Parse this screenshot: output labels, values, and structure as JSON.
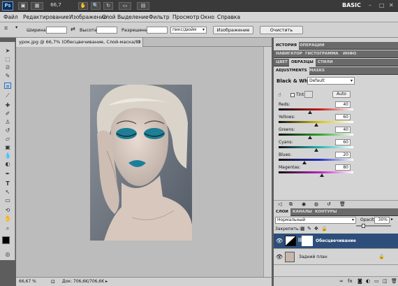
{
  "appbar": {
    "logo": "Ps",
    "zoom": "66,7",
    "workspace": "BASIC"
  },
  "menu": [
    "Файл",
    "Редактирование",
    "Изображение",
    "Слой",
    "Выделение",
    "Фильтр",
    "Просмотр",
    "Окно",
    "Справка"
  ],
  "options": {
    "width_label": "Ширина:",
    "height_label": "Высота:",
    "res_label": "Разрешение:",
    "units": "пикс/дюйм",
    "image_btn": "Изображение",
    "clear_btn": "Очистить"
  },
  "document": {
    "tab_title": "урок.jpg @ 66,7% (Обесцвечивание, Слой-маска/8) *",
    "zoom": "66,67 %",
    "doc_info": "Док: 706,6K/706,6K"
  },
  "panels": {
    "row1": [
      "ИСТОРИЯ",
      "ОПЕРАЦИИ"
    ],
    "row2": [
      "НАВИГАТОР",
      "ГИСТОГРАММА",
      "ИНФО"
    ],
    "row3": [
      "ЦВЕТ",
      "ОБРАЗЦЫ",
      "СТИЛИ"
    ],
    "row4": [
      "ADJUSTMENTS",
      "MASKS"
    ],
    "bw_title": "Black & White",
    "preset": "Default",
    "tint": "Tint",
    "auto": "Auto",
    "sliders": [
      {
        "label": "Reds:",
        "value": "40",
        "pct": 0.42,
        "color": "#c41a1a"
      },
      {
        "label": "Yellows:",
        "value": "60",
        "pct": 0.5,
        "color": "#d9c21a"
      },
      {
        "label": "Greens:",
        "value": "40",
        "pct": 0.42,
        "color": "#2aa32a"
      },
      {
        "label": "Cyans:",
        "value": "60",
        "pct": 0.5,
        "color": "#23b4b4"
      },
      {
        "label": "Blues:",
        "value": "20",
        "pct": 0.35,
        "color": "#2430c4"
      },
      {
        "label": "Magentas:",
        "value": "80",
        "pct": 0.58,
        "color": "#c021c0"
      }
    ]
  },
  "layers": {
    "tabs": [
      "СЛОИ",
      "КАНАЛЫ",
      "КОНТУРЫ"
    ],
    "blend": "Нормальный",
    "opacity_label": "Opacity:",
    "opacity": "30%",
    "lock_label": "Закрепить:",
    "items": [
      {
        "name": "Обесцвечивание",
        "selected": true
      },
      {
        "name": "Задний план",
        "selected": false
      }
    ]
  }
}
